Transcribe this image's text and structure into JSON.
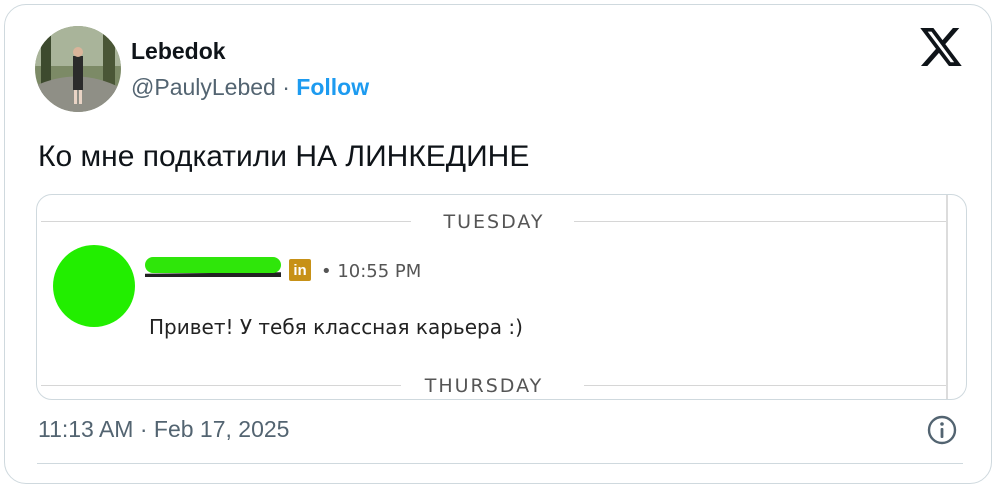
{
  "author": {
    "name": "Lebedok",
    "handle": "@PaulyLebed",
    "separator": "·",
    "follow_label": "Follow"
  },
  "icons": {
    "brand": "x-logo-icon",
    "info": "info-icon",
    "linkedin_badge": "linkedin-icon"
  },
  "tweet": {
    "text": "Ко мне подкатили НА ЛИНКЕДИНЕ",
    "timestamp": "11:13 AM · Feb 17, 2025"
  },
  "screenshot": {
    "day1": "TUESDAY",
    "day2": "THURSDAY",
    "message": {
      "badge_text": "in",
      "time": "• 10:55 PM",
      "text": "Привет! У тебя классная карьера :)"
    }
  },
  "colors": {
    "follow": "#1d9bf0",
    "redaction_green": "#22ee00",
    "linkedin_badge": "#c79117"
  }
}
